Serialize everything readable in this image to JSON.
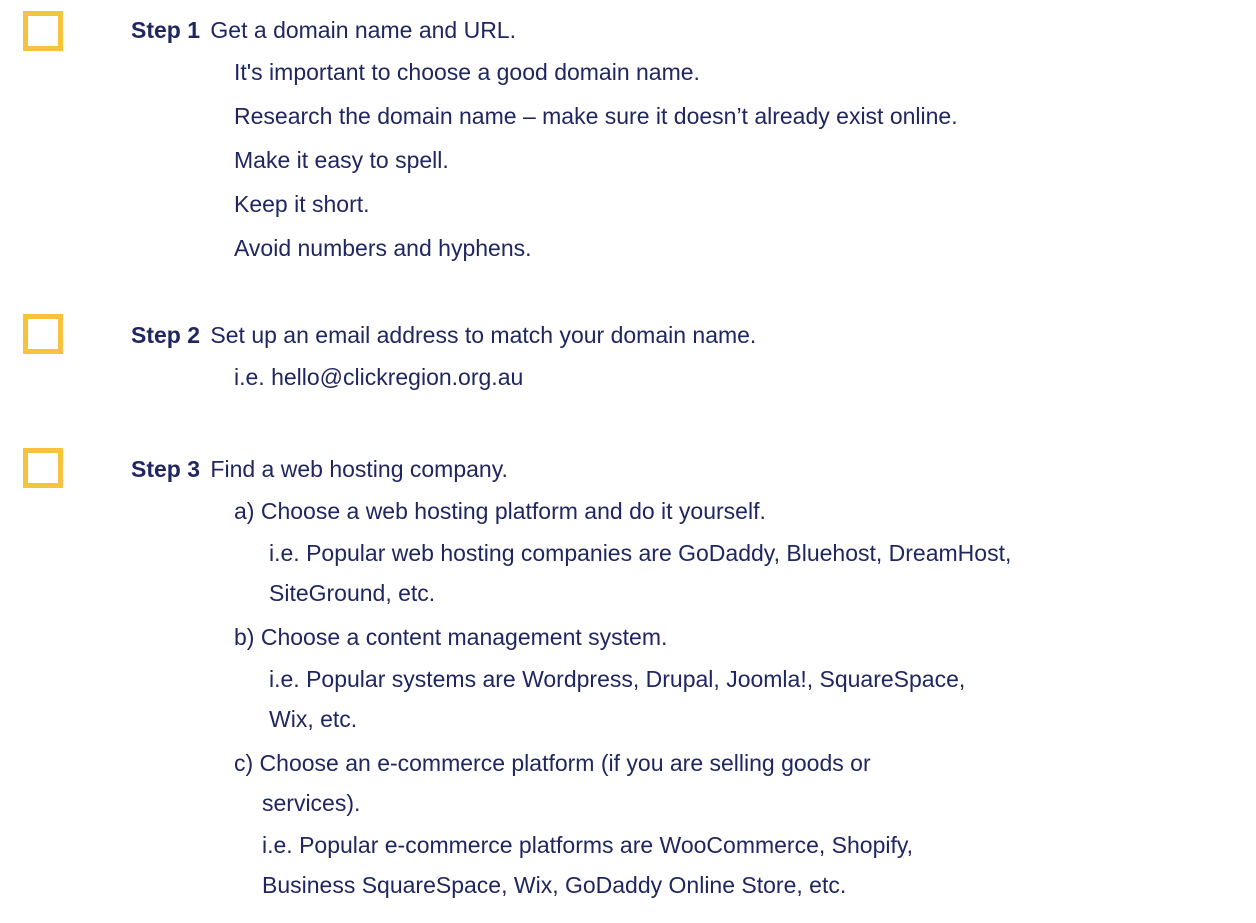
{
  "steps": [
    {
      "label": "Step 1",
      "title": "Get a domain name and URL.",
      "lines": [
        "It's important to choose a good domain name.",
        "Research the domain name – make sure it doesn’t already exist online.",
        "Make it easy to spell.",
        "Keep it short.",
        "Avoid numbers and hyphens."
      ]
    },
    {
      "label": "Step 2",
      "title": "Set up an email address to match your domain name.",
      "lines": [
        "i.e. hello@clickregion.org.au"
      ]
    },
    {
      "label": "Step 3",
      "title": "Find a web hosting company.",
      "options": [
        {
          "text": "a) Choose a web hosting platform and do it yourself.",
          "detail": [
            "i.e. Popular web hosting companies are GoDaddy, Bluehost, DreamHost,",
            "SiteGround, etc."
          ]
        },
        {
          "text": "b) Choose a content management system.",
          "detail": [
            "i.e. Popular systems are Wordpress, Drupal, Joomla!, SquareSpace,",
            "Wix, etc."
          ]
        },
        {
          "text_lines": [
            "c) Choose an e-commerce platform (if you are selling goods or",
            "services)."
          ],
          "detail": [
            "i.e. Popular e-commerce platforms are WooCommerce, Shopify,",
            "Business SquareSpace, Wix, GoDaddy Online Store, etc."
          ]
        }
      ]
    }
  ],
  "colors": {
    "text": "#1f2660",
    "checkbox_border": "#f7c23e"
  }
}
